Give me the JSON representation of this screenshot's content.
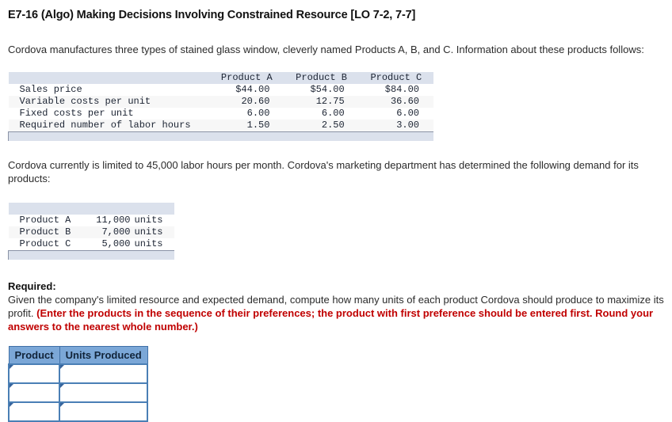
{
  "question": {
    "title": "E7-16 (Algo) Making Decisions Involving Constrained Resource [LO 7-2, 7-7]",
    "intro_paragraph": "Cordova manufactures three types of stained glass window, cleverly named Products A, B, and C. Information about these products follows:",
    "constraint_paragraph": "Cordova currently is limited to 45,000 labor hours per month. Cordova's marketing department has determined the following demand for its products:"
  },
  "product_table": {
    "column_headers": [
      "",
      "Product A",
      "Product B",
      "Product C"
    ],
    "rows": [
      {
        "label": "Sales price",
        "a": "$44.00",
        "b": "$54.00",
        "c": "$84.00"
      },
      {
        "label": "Variable costs per unit",
        "a": "20.60",
        "b": "12.75",
        "c": "36.60"
      },
      {
        "label": "Fixed costs per unit",
        "a": "6.00",
        "b": "6.00",
        "c": "6.00"
      },
      {
        "label": "Required number of labor hours",
        "a": "1.50",
        "b": "2.50",
        "c": "3.00"
      }
    ]
  },
  "demand_table": {
    "rows": [
      {
        "product": "Product A",
        "quantity": "11,000",
        "unit": "units"
      },
      {
        "product": "Product B",
        "quantity": "7,000",
        "unit": "units"
      },
      {
        "product": "Product C",
        "quantity": "5,000",
        "unit": "units"
      }
    ]
  },
  "required": {
    "label": "Required:",
    "instruction_plain": "Given the company's limited resource and expected demand, compute how many units of each product Cordova should produce to maximize its profit.",
    "instruction_emphasis": "(Enter the products in the sequence of their preferences; the product with first preference should be entered first. Round your answers to the nearest whole number.)",
    "emphasis_color": "#c00000"
  },
  "answer_table": {
    "headers": [
      "Product",
      "Units Produced"
    ],
    "rows": [
      {
        "product": "",
        "units_produced": ""
      },
      {
        "product": "",
        "units_produced": ""
      },
      {
        "product": "",
        "units_produced": ""
      }
    ],
    "header_color": "#7ba7d7",
    "border_color": "#4a7fb5"
  }
}
